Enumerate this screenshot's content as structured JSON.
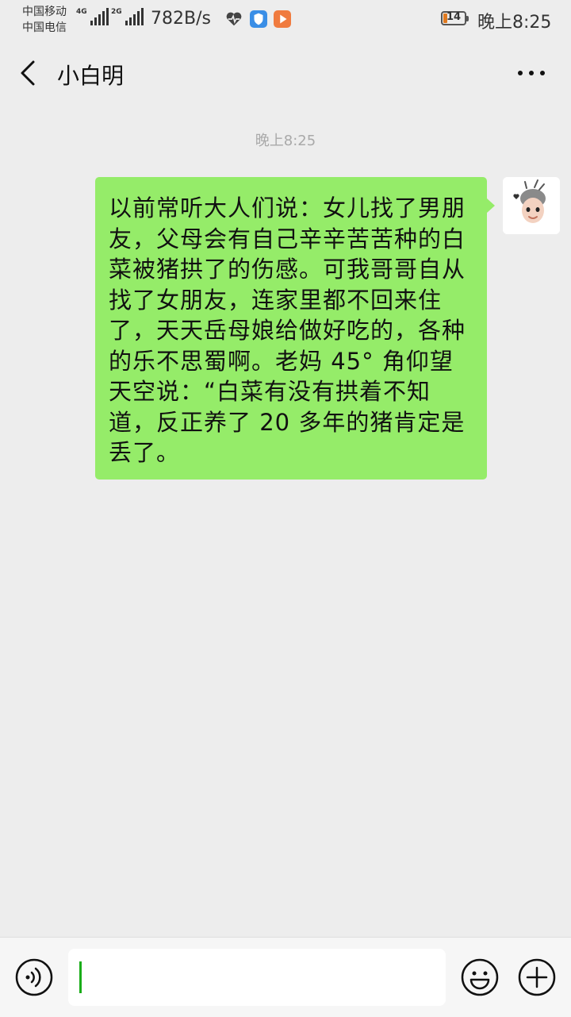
{
  "status_bar": {
    "carrier_1": "中国移动",
    "carrier_2": "中国电信",
    "signal_1_label": "4G",
    "signal_2_label": "2G",
    "net_speed": "782B/s",
    "icons": [
      "heartbeat-icon",
      "shield-icon",
      "video-play-icon"
    ],
    "battery_level": "14",
    "time": "晚上8:25"
  },
  "header": {
    "title": "小白明",
    "back_icon": "back-chevron-icon",
    "more_icon": "more-dots-icon"
  },
  "chat": {
    "timestamp": "晚上8:25",
    "messages": [
      {
        "side": "right",
        "bubble_color": "#95ec69",
        "text": "以前常听大人们说：女儿找了男朋友，父母会有自己辛辛苦苦种的白菜被猪拱了的伤感。可我哥哥自从找了女朋友，连家里都不回来住了，天天岳母娘给做好吃的，各种的乐不思蜀啊。老妈 45° 角仰望天空说：“白菜有没有拱着不知道，反正养了 20 多年的猪肯定是丢了。"
      }
    ]
  },
  "input_bar": {
    "value": "",
    "voice_icon": "voice-icon",
    "emoji_icon": "emoji-icon",
    "plus_icon": "plus-icon",
    "caret_color": "#1aad19"
  }
}
